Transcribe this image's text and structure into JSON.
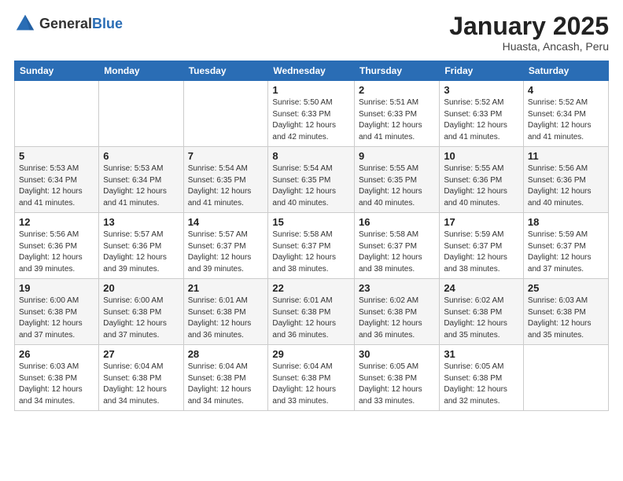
{
  "logo": {
    "general": "General",
    "blue": "Blue"
  },
  "title": "January 2025",
  "subtitle": "Huasta, Ancash, Peru",
  "weekdays": [
    "Sunday",
    "Monday",
    "Tuesday",
    "Wednesday",
    "Thursday",
    "Friday",
    "Saturday"
  ],
  "weeks": [
    [
      {
        "day": "",
        "sunrise": "",
        "sunset": "",
        "daylight": ""
      },
      {
        "day": "",
        "sunrise": "",
        "sunset": "",
        "daylight": ""
      },
      {
        "day": "",
        "sunrise": "",
        "sunset": "",
        "daylight": ""
      },
      {
        "day": "1",
        "sunrise": "Sunrise: 5:50 AM",
        "sunset": "Sunset: 6:33 PM",
        "daylight": "Daylight: 12 hours and 42 minutes."
      },
      {
        "day": "2",
        "sunrise": "Sunrise: 5:51 AM",
        "sunset": "Sunset: 6:33 PM",
        "daylight": "Daylight: 12 hours and 41 minutes."
      },
      {
        "day": "3",
        "sunrise": "Sunrise: 5:52 AM",
        "sunset": "Sunset: 6:33 PM",
        "daylight": "Daylight: 12 hours and 41 minutes."
      },
      {
        "day": "4",
        "sunrise": "Sunrise: 5:52 AM",
        "sunset": "Sunset: 6:34 PM",
        "daylight": "Daylight: 12 hours and 41 minutes."
      }
    ],
    [
      {
        "day": "5",
        "sunrise": "Sunrise: 5:53 AM",
        "sunset": "Sunset: 6:34 PM",
        "daylight": "Daylight: 12 hours and 41 minutes."
      },
      {
        "day": "6",
        "sunrise": "Sunrise: 5:53 AM",
        "sunset": "Sunset: 6:34 PM",
        "daylight": "Daylight: 12 hours and 41 minutes."
      },
      {
        "day": "7",
        "sunrise": "Sunrise: 5:54 AM",
        "sunset": "Sunset: 6:35 PM",
        "daylight": "Daylight: 12 hours and 41 minutes."
      },
      {
        "day": "8",
        "sunrise": "Sunrise: 5:54 AM",
        "sunset": "Sunset: 6:35 PM",
        "daylight": "Daylight: 12 hours and 40 minutes."
      },
      {
        "day": "9",
        "sunrise": "Sunrise: 5:55 AM",
        "sunset": "Sunset: 6:35 PM",
        "daylight": "Daylight: 12 hours and 40 minutes."
      },
      {
        "day": "10",
        "sunrise": "Sunrise: 5:55 AM",
        "sunset": "Sunset: 6:36 PM",
        "daylight": "Daylight: 12 hours and 40 minutes."
      },
      {
        "day": "11",
        "sunrise": "Sunrise: 5:56 AM",
        "sunset": "Sunset: 6:36 PM",
        "daylight": "Daylight: 12 hours and 40 minutes."
      }
    ],
    [
      {
        "day": "12",
        "sunrise": "Sunrise: 5:56 AM",
        "sunset": "Sunset: 6:36 PM",
        "daylight": "Daylight: 12 hours and 39 minutes."
      },
      {
        "day": "13",
        "sunrise": "Sunrise: 5:57 AM",
        "sunset": "Sunset: 6:36 PM",
        "daylight": "Daylight: 12 hours and 39 minutes."
      },
      {
        "day": "14",
        "sunrise": "Sunrise: 5:57 AM",
        "sunset": "Sunset: 6:37 PM",
        "daylight": "Daylight: 12 hours and 39 minutes."
      },
      {
        "day": "15",
        "sunrise": "Sunrise: 5:58 AM",
        "sunset": "Sunset: 6:37 PM",
        "daylight": "Daylight: 12 hours and 38 minutes."
      },
      {
        "day": "16",
        "sunrise": "Sunrise: 5:58 AM",
        "sunset": "Sunset: 6:37 PM",
        "daylight": "Daylight: 12 hours and 38 minutes."
      },
      {
        "day": "17",
        "sunrise": "Sunrise: 5:59 AM",
        "sunset": "Sunset: 6:37 PM",
        "daylight": "Daylight: 12 hours and 38 minutes."
      },
      {
        "day": "18",
        "sunrise": "Sunrise: 5:59 AM",
        "sunset": "Sunset: 6:37 PM",
        "daylight": "Daylight: 12 hours and 37 minutes."
      }
    ],
    [
      {
        "day": "19",
        "sunrise": "Sunrise: 6:00 AM",
        "sunset": "Sunset: 6:38 PM",
        "daylight": "Daylight: 12 hours and 37 minutes."
      },
      {
        "day": "20",
        "sunrise": "Sunrise: 6:00 AM",
        "sunset": "Sunset: 6:38 PM",
        "daylight": "Daylight: 12 hours and 37 minutes."
      },
      {
        "day": "21",
        "sunrise": "Sunrise: 6:01 AM",
        "sunset": "Sunset: 6:38 PM",
        "daylight": "Daylight: 12 hours and 36 minutes."
      },
      {
        "day": "22",
        "sunrise": "Sunrise: 6:01 AM",
        "sunset": "Sunset: 6:38 PM",
        "daylight": "Daylight: 12 hours and 36 minutes."
      },
      {
        "day": "23",
        "sunrise": "Sunrise: 6:02 AM",
        "sunset": "Sunset: 6:38 PM",
        "daylight": "Daylight: 12 hours and 36 minutes."
      },
      {
        "day": "24",
        "sunrise": "Sunrise: 6:02 AM",
        "sunset": "Sunset: 6:38 PM",
        "daylight": "Daylight: 12 hours and 35 minutes."
      },
      {
        "day": "25",
        "sunrise": "Sunrise: 6:03 AM",
        "sunset": "Sunset: 6:38 PM",
        "daylight": "Daylight: 12 hours and 35 minutes."
      }
    ],
    [
      {
        "day": "26",
        "sunrise": "Sunrise: 6:03 AM",
        "sunset": "Sunset: 6:38 PM",
        "daylight": "Daylight: 12 hours and 34 minutes."
      },
      {
        "day": "27",
        "sunrise": "Sunrise: 6:04 AM",
        "sunset": "Sunset: 6:38 PM",
        "daylight": "Daylight: 12 hours and 34 minutes."
      },
      {
        "day": "28",
        "sunrise": "Sunrise: 6:04 AM",
        "sunset": "Sunset: 6:38 PM",
        "daylight": "Daylight: 12 hours and 34 minutes."
      },
      {
        "day": "29",
        "sunrise": "Sunrise: 6:04 AM",
        "sunset": "Sunset: 6:38 PM",
        "daylight": "Daylight: 12 hours and 33 minutes."
      },
      {
        "day": "30",
        "sunrise": "Sunrise: 6:05 AM",
        "sunset": "Sunset: 6:38 PM",
        "daylight": "Daylight: 12 hours and 33 minutes."
      },
      {
        "day": "31",
        "sunrise": "Sunrise: 6:05 AM",
        "sunset": "Sunset: 6:38 PM",
        "daylight": "Daylight: 12 hours and 32 minutes."
      },
      {
        "day": "",
        "sunrise": "",
        "sunset": "",
        "daylight": ""
      }
    ]
  ]
}
